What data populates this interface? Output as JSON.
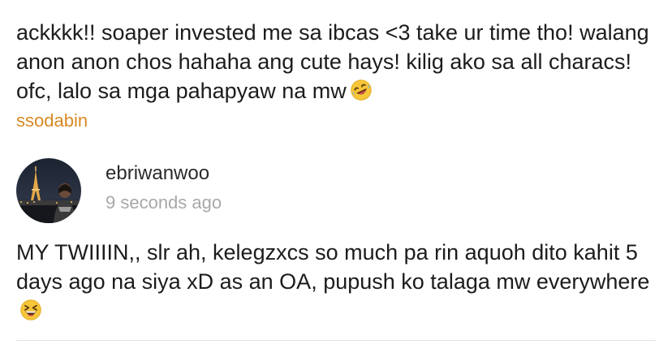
{
  "quoted_comment": {
    "text": "ackkkk!! soaper invested me sa ibcas <3 take ur time tho! walang anon anon chos hahaha ang cute hays! kilig ako sa all characs! ofc, lalo sa mga pahapyaw na mw",
    "emoji": "rolling-on-floor-laughing",
    "author": "ssodabin",
    "author_color": "#d88a24"
  },
  "reply": {
    "username": "ebriwanwoo",
    "timestamp": "9 seconds ago",
    "text": "MY TWIIIIN,, slr ah, kelegzxcs so much pa rin aquoh dito kahit 5 days ago na siya xD as an OA, pupush ko talaga mw everywhere",
    "emoji": "grinning-squinting-face"
  }
}
